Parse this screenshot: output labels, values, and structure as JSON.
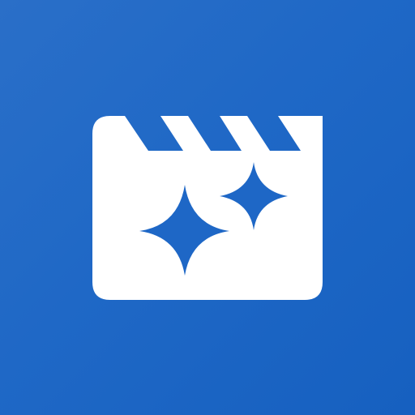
{
  "app_icon": {
    "icon": "video-editor-sparkle-icon",
    "background_color": "#1e67c6",
    "foreground_color": "#ffffff",
    "sparkle_color": "#1e67c6"
  }
}
